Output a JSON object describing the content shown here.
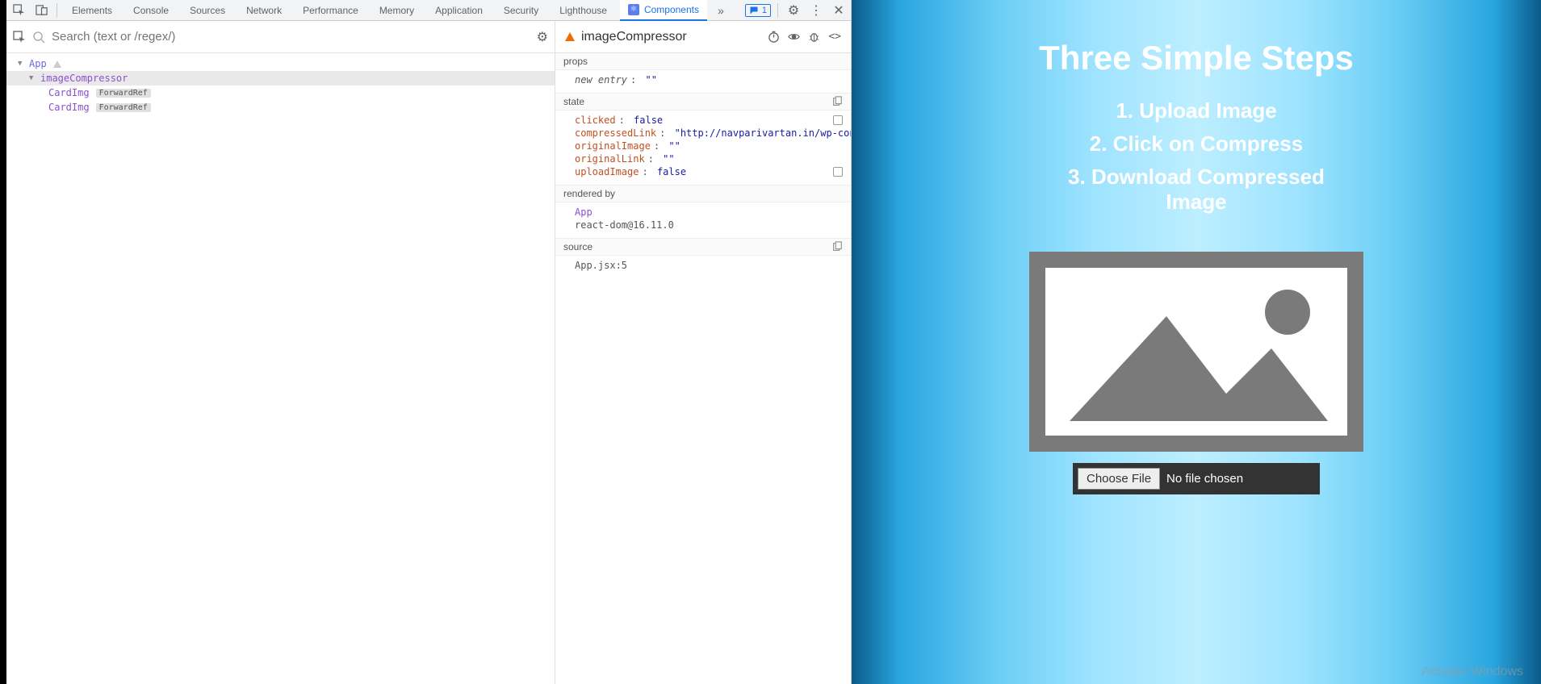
{
  "tabs": {
    "elements": "Elements",
    "console": "Console",
    "sources": "Sources",
    "network": "Network",
    "performance": "Performance",
    "memory": "Memory",
    "application": "Application",
    "security": "Security",
    "lighthouse": "Lighthouse",
    "components": "Components"
  },
  "feedback_count": "1",
  "search": {
    "placeholder": "Search (text or /regex/)"
  },
  "selected_component": "imageCompressor",
  "tree": {
    "root": "App",
    "nodes": [
      {
        "name": "imageCompressor",
        "badge": null
      },
      {
        "name": "CardImg",
        "badge": "ForwardRef"
      },
      {
        "name": "CardImg",
        "badge": "ForwardRef"
      }
    ]
  },
  "sections": {
    "props_label": "props",
    "state_label": "state",
    "rendered_label": "rendered by",
    "source_label": "source"
  },
  "props": {
    "new_entry_key": "new entry",
    "new_entry_val": "\"\""
  },
  "state": {
    "clicked_key": "clicked",
    "clicked_val": "false",
    "compressedLink_key": "compressedLink",
    "compressedLink_val": "\"http://navparivartan.in/wp-content/up",
    "originalImage_key": "originalImage",
    "originalImage_val": "\"\"",
    "originalLink_key": "originalLink",
    "originalLink_val": "\"\"",
    "uploadImage_key": "uploadImage",
    "uploadImage_val": "false"
  },
  "rendered": {
    "parent": "App",
    "version": "react-dom@16.11.0"
  },
  "source": {
    "loc": "App.jsx:5"
  },
  "app": {
    "title": "Three Simple Steps",
    "steps": [
      "1. Upload Image",
      "2. Click on Compress",
      "3. Download Compressed Image"
    ],
    "choose_btn": "Choose File",
    "file_status": "No file chosen",
    "watermark": "Activate Windows"
  }
}
